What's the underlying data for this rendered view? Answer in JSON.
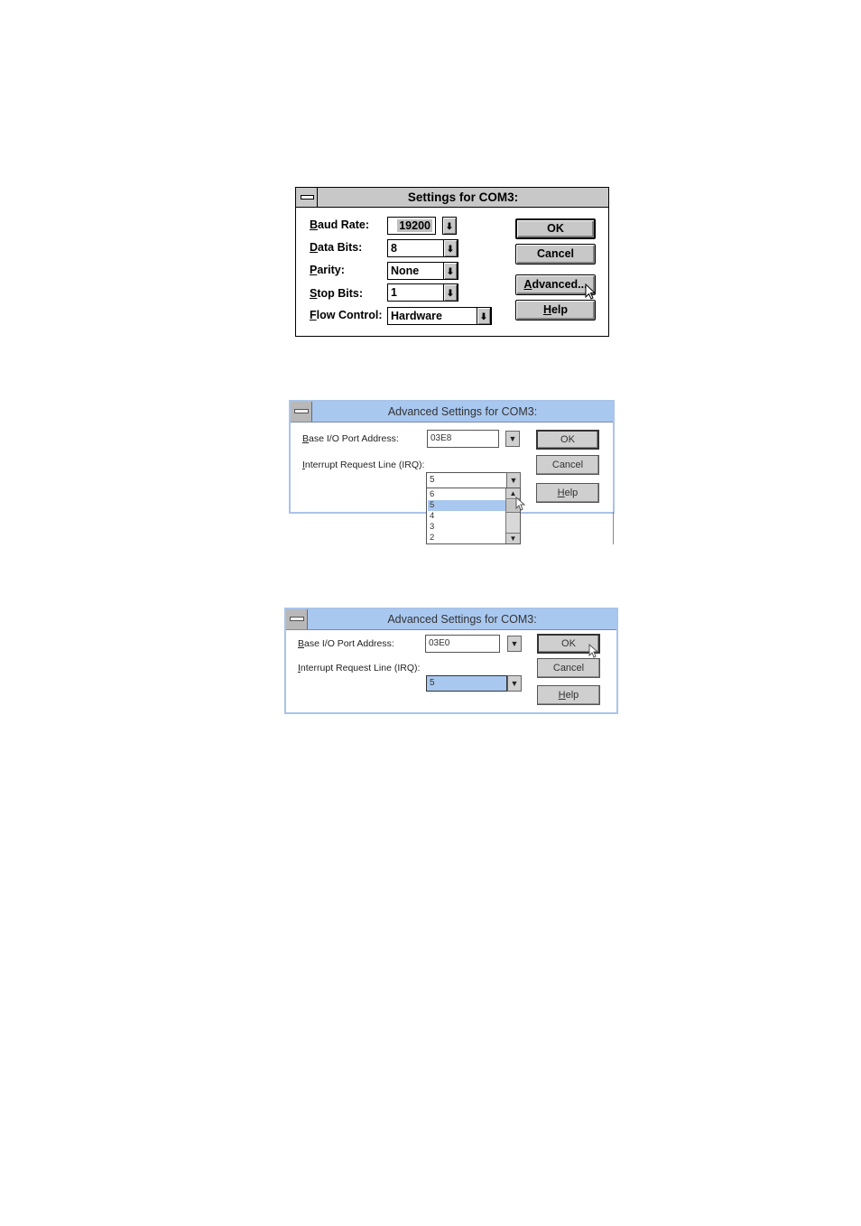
{
  "dialog_settings": {
    "title": "Settings for COM3:",
    "fields": [
      {
        "label_key": "B",
        "label_rest": "aud Rate:",
        "value": "19200"
      },
      {
        "label_key": "D",
        "label_rest": "ata Bits:",
        "value": "8"
      },
      {
        "label_key": "P",
        "label_rest": "arity:",
        "value": "None"
      },
      {
        "label_key": "S",
        "label_rest": "top Bits:",
        "value": "1"
      },
      {
        "label_key": "F",
        "label_rest": "low Control:",
        "value": "Hardware"
      }
    ],
    "buttons": {
      "ok": "OK",
      "cancel": "Cancel",
      "advanced_key": "A",
      "advanced_rest": "dvanced...",
      "help_key": "H",
      "help_rest": "elp"
    },
    "dropdown_arrow": "⬇"
  },
  "dialog_advanced_open": {
    "title": "Advanced Settings for COM3:",
    "base_io_label_key": "B",
    "base_io_label_rest": "ase I/O Port Address:",
    "base_io_value": "03E8",
    "irq_label_key": "I",
    "irq_label_rest": "nterrupt Request Line (IRQ):",
    "irq_value": "5",
    "irq_options": [
      "6",
      "5",
      "4",
      "3",
      "2"
    ],
    "irq_selected": "5",
    "buttons": {
      "ok": "OK",
      "cancel": "Cancel",
      "help_key": "H",
      "help_rest": "elp"
    }
  },
  "dialog_advanced_closed": {
    "title": "Advanced Settings for COM3:",
    "base_io_label_key": "B",
    "base_io_label_rest": "ase I/O Port Address:",
    "base_io_value": "03E0",
    "irq_label_key": "I",
    "irq_label_rest": "nterrupt Request Line (IRQ):",
    "irq_value": "5",
    "buttons": {
      "ok": "OK",
      "cancel": "Cancel",
      "help_key": "H",
      "help_rest": "elp"
    }
  },
  "icons": {
    "arrow_down": "▼",
    "arrow_up": "▲",
    "cursor": "mouse-pointer-icon"
  },
  "colors": {
    "classic_gray": "#c8c8c8",
    "title_blue": "#a9c8f0",
    "selection_blue": "#a9c8f0"
  }
}
